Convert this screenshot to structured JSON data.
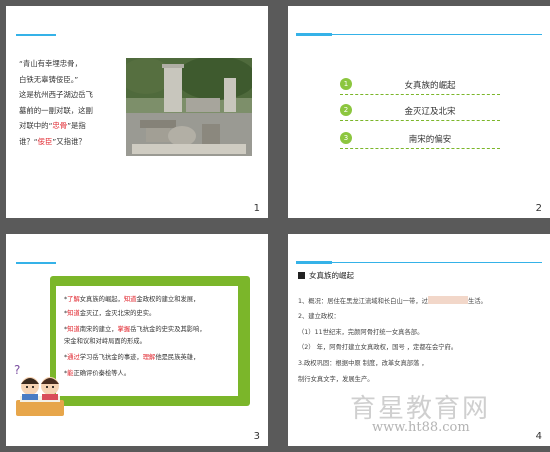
{
  "slides": [
    {
      "number": "1"
    },
    {
      "number": "2"
    },
    {
      "number": "3"
    },
    {
      "number": "4"
    }
  ],
  "slide1": {
    "lines": [
      [
        "“青山有幸埋忠骨，",
        ""
      ],
      [
        "白铁无辜铸佞臣。”",
        ""
      ],
      [
        "这是杭州西子湖边岳飞",
        ""
      ],
      [
        "墓前的一副对联，这副",
        ""
      ],
      [
        "对联中的“",
        "忠骨",
        "”是指"
      ],
      [
        "谁？“",
        "佞臣",
        "”又指谁？"
      ]
    ]
  },
  "slide2": {
    "items": [
      {
        "n": "1",
        "label": "女真族的崛起"
      },
      {
        "n": "2",
        "label": "金灭辽及北宋"
      },
      {
        "n": "3",
        "label": "南宋的偏安"
      }
    ]
  },
  "slide3": {
    "lines": [
      {
        "a": "了解",
        "b": "女真族的崛起，",
        "c": "知道",
        "d": "金政权的建立和发展，"
      },
      {
        "a": "知道",
        "b": "金灭辽，金灭北宋的史实。",
        "c": "",
        "d": ""
      },
      {
        "a": "知道",
        "b": "南宋的建立，",
        "c": "掌握",
        "d": "岳飞抗金的史实及其影响，"
      },
      {
        "a": "知道",
        "b": "宋金和议和对峙局面的形成。",
        "c": "",
        "d": ""
      },
      {
        "a": "通过",
        "b": "学习岳飞抗金的事迹，",
        "c": "理解",
        "d": "他是民族英雄，"
      },
      {
        "a": "能",
        "b": "正确评价秦桧等人。",
        "c": "",
        "d": ""
      }
    ]
  },
  "slide4": {
    "title": "女真族的崛起",
    "lines": [
      "1、概况：居住在黑龙江流域和长白山一带，过",
      "2、建立政权：",
      "（1）11世纪末，完颜阿骨打统一女真各部。",
      "（2）      年，阿骨打建立女真政权，国号      ，定都在会宁府。",
      "3.政权巩固：根据中原        制度，改革女真部落       ，",
      "制行女真文字，发展生产。"
    ],
    "line1_tail": "生活。"
  },
  "watermark": {
    "cn": "育星教育网",
    "url": "www.ht88.com"
  }
}
